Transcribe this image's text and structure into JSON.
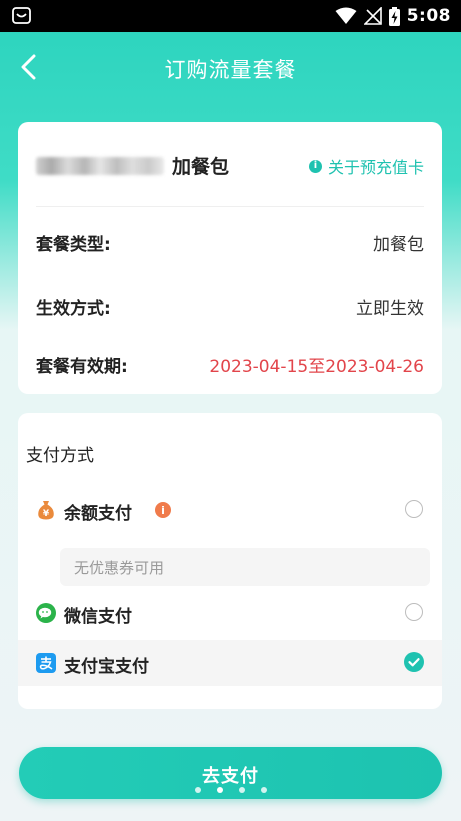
{
  "status_bar": {
    "time": "5:08",
    "icons": [
      "app-notification-icon",
      "wifi-icon",
      "no-signal-icon",
      "battery-charging-icon"
    ]
  },
  "header": {
    "back_icon": "chevron-left-icon",
    "title": "订购流量套餐"
  },
  "package": {
    "name_suffix": "加餐包",
    "prepaid_link": "关于预充值卡",
    "rows": [
      {
        "label": "套餐类型:",
        "value": "加餐包"
      },
      {
        "label": "生效方式:",
        "value": "立即生效"
      },
      {
        "label": "套餐有效期:",
        "value": "2023-04-15至2023-04-26"
      }
    ],
    "validity_color": "#e2454b"
  },
  "payment": {
    "section_title": "支付方式",
    "methods": [
      {
        "label": "余额支付",
        "icon": "money-bag-icon",
        "has_info": true,
        "selected": false
      },
      {
        "label": "微信支付",
        "icon": "wechat-icon",
        "has_info": false,
        "selected": false
      },
      {
        "label": "支付宝支付",
        "icon": "alipay-icon",
        "has_info": false,
        "selected": true
      }
    ],
    "coupon_text": "无优惠券可用"
  },
  "actions": {
    "pay_button_label": "去支付"
  },
  "colors": {
    "accent": "#1fc2b0",
    "warning": "#f07b4b"
  }
}
